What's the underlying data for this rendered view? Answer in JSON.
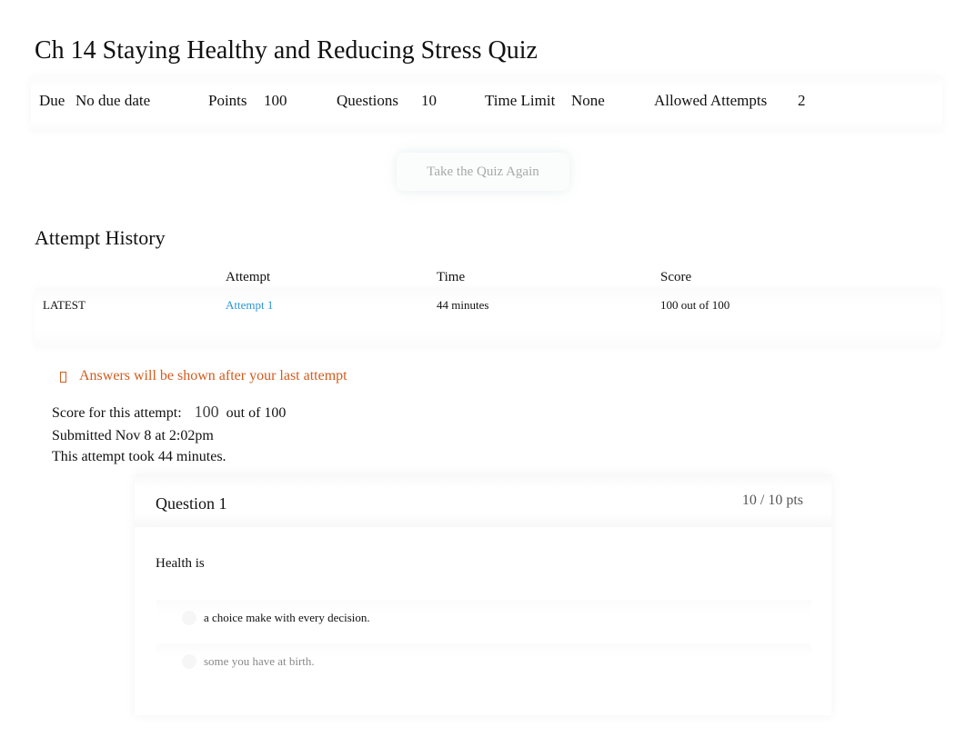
{
  "page_title": "Ch 14 Staying Healthy and Reducing Stress Quiz",
  "details": {
    "due_label": "Due",
    "due_value": "No due date",
    "points_label": "Points",
    "points_value": "100",
    "questions_label": "Questions",
    "questions_value": "10",
    "time_limit_label": "Time Limit",
    "time_limit_value": "None",
    "allowed_attempts_label": "Allowed Attempts",
    "allowed_attempts_value": "2"
  },
  "take_quiz_button": "Take the Quiz Again",
  "attempt_history": {
    "heading": "Attempt History",
    "columns": [
      "",
      "Attempt",
      "Time",
      "Score"
    ],
    "rows": [
      {
        "tag": "LATEST",
        "attempt": "Attempt 1",
        "time": "44 minutes",
        "score": "100 out of 100"
      }
    ]
  },
  "notice": {
    "icon": "warning-icon",
    "text": "Answers will be shown after your last attempt",
    "color": "#d35b1d"
  },
  "attempt_summary": {
    "score_label": "Score for this attempt:",
    "score_value": "100",
    "score_suffix": "out of 100",
    "submitted": "Submitted Nov 8 at 2:02pm",
    "duration": "This attempt took 44 minutes."
  },
  "questions": [
    {
      "title": "Question 1",
      "points": "10 / 10 pts",
      "text": "Health is",
      "answers": [
        {
          "label": "a choice make with every decision.",
          "selected": true
        },
        {
          "label": "some you have at birth.",
          "selected": false
        }
      ]
    }
  ],
  "colors": {
    "link": "#2b96d6",
    "warning": "#d35b1d"
  }
}
